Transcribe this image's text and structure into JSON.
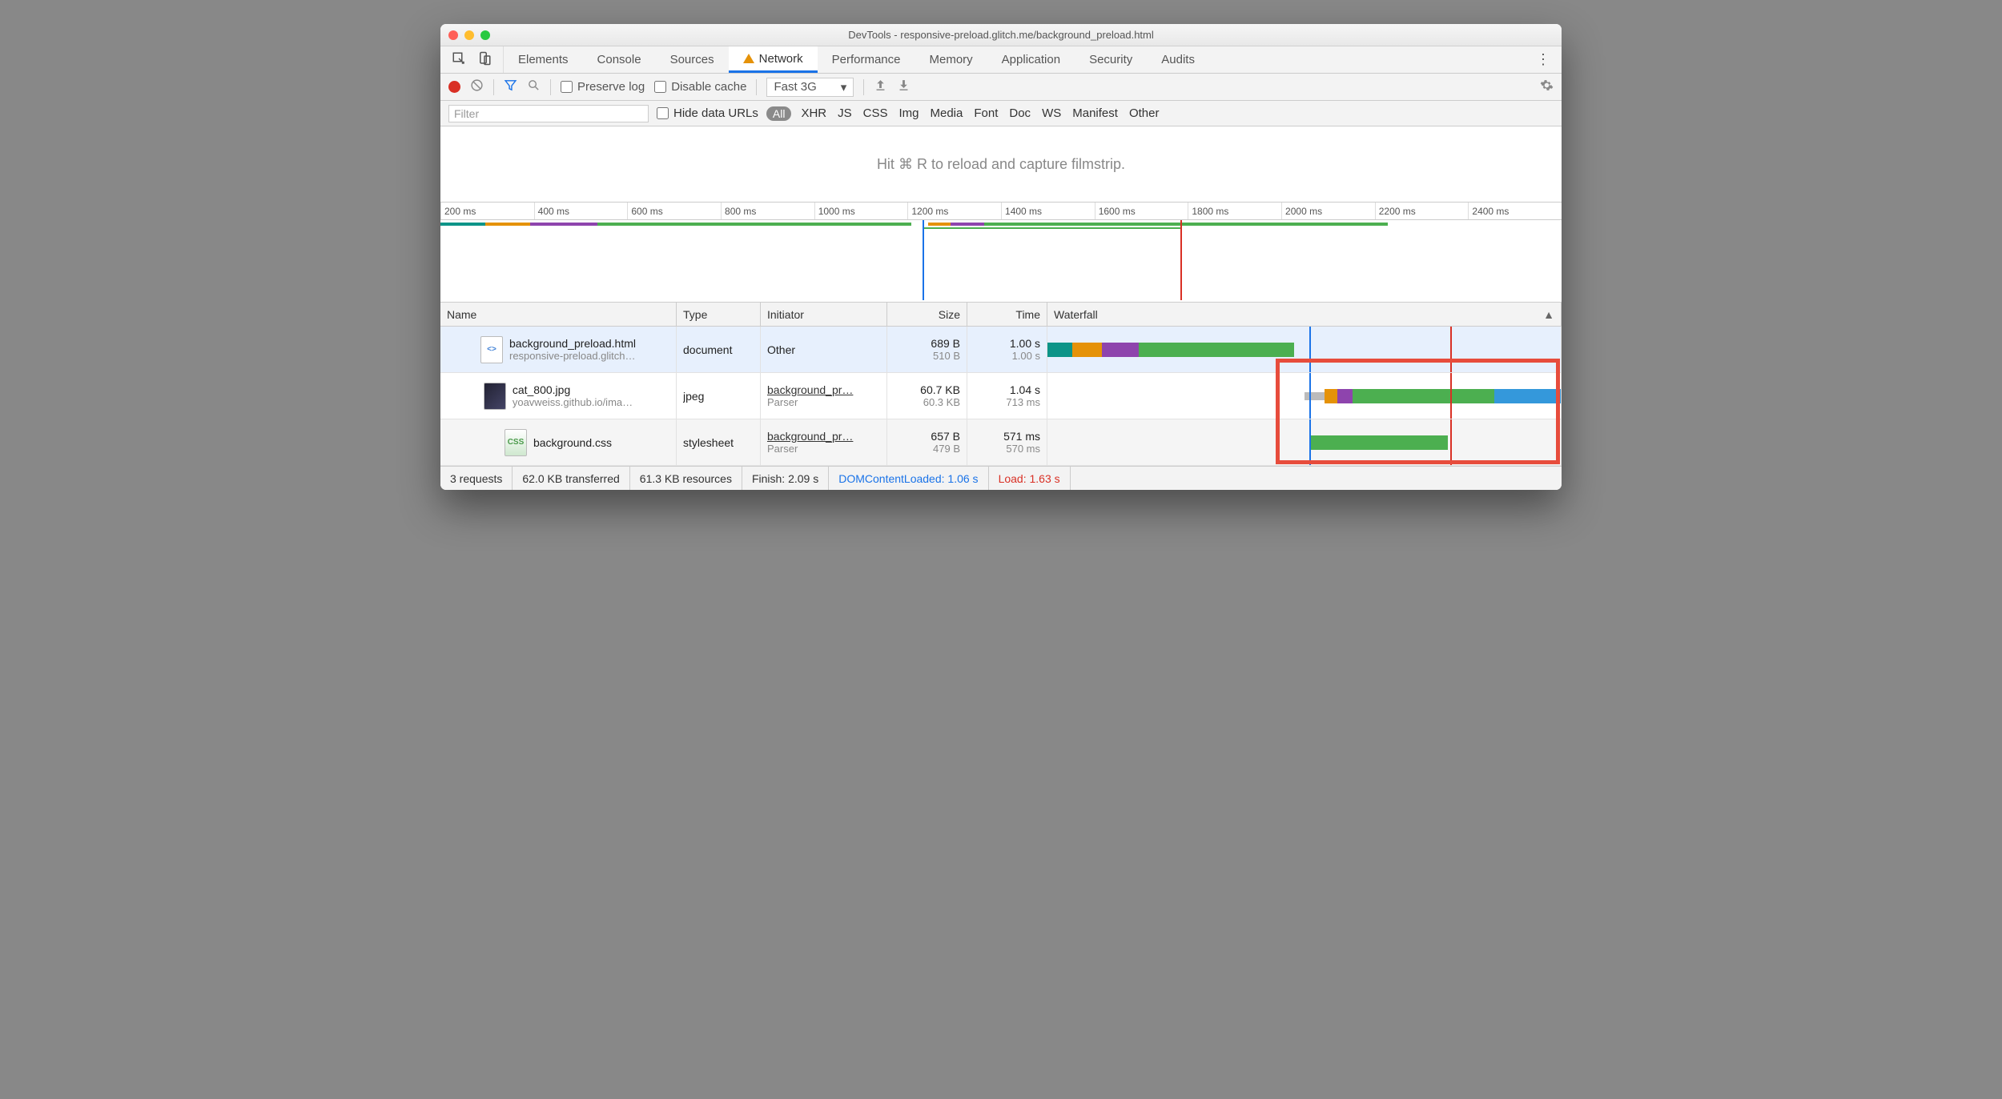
{
  "window": {
    "title": "DevTools - responsive-preload.glitch.me/background_preload.html"
  },
  "tabs": [
    "Elements",
    "Console",
    "Sources",
    "Network",
    "Performance",
    "Memory",
    "Application",
    "Security",
    "Audits"
  ],
  "active_tab": "Network",
  "toolbar": {
    "preserve_log": "Preserve log",
    "disable_cache": "Disable cache",
    "throttle": "Fast 3G"
  },
  "filter": {
    "placeholder": "Filter",
    "hide_urls": "Hide data URLs",
    "types": [
      "All",
      "XHR",
      "JS",
      "CSS",
      "Img",
      "Media",
      "Font",
      "Doc",
      "WS",
      "Manifest",
      "Other"
    ]
  },
  "filmstrip_hint": "Hit ⌘ R to reload and capture filmstrip.",
  "overview_ticks": [
    "200 ms",
    "400 ms",
    "600 ms",
    "800 ms",
    "1000 ms",
    "1200 ms",
    "1400 ms",
    "1600 ms",
    "1800 ms",
    "2000 ms",
    "2200 ms",
    "2400 ms"
  ],
  "columns": {
    "name": "Name",
    "type": "Type",
    "initiator": "Initiator",
    "size": "Size",
    "time": "Time",
    "waterfall": "Waterfall"
  },
  "requests": [
    {
      "name": "background_preload.html",
      "sub": "responsive-preload.glitch…",
      "type": "document",
      "initiator": "Other",
      "initiator_sub": "",
      "size": "689 B",
      "size_sub": "510 B",
      "time": "1.00 s",
      "time_sub": "1.00 s",
      "icon": "html"
    },
    {
      "name": "cat_800.jpg",
      "sub": "yoavweiss.github.io/ima…",
      "type": "jpeg",
      "initiator": "background_pr…",
      "initiator_sub": "Parser",
      "size": "60.7 KB",
      "size_sub": "60.3 KB",
      "time": "1.04 s",
      "time_sub": "713 ms",
      "icon": "img"
    },
    {
      "name": "background.css",
      "sub": "",
      "type": "stylesheet",
      "initiator": "background_pr…",
      "initiator_sub": "Parser",
      "size": "657 B",
      "size_sub": "479 B",
      "time": "571 ms",
      "time_sub": "570 ms",
      "icon": "css"
    }
  ],
  "status": {
    "requests": "3 requests",
    "transferred": "62.0 KB transferred",
    "resources": "61.3 KB resources",
    "finish": "Finish: 2.09 s",
    "dcl": "DOMContentLoaded: 1.06 s",
    "load": "Load: 1.63 s"
  }
}
